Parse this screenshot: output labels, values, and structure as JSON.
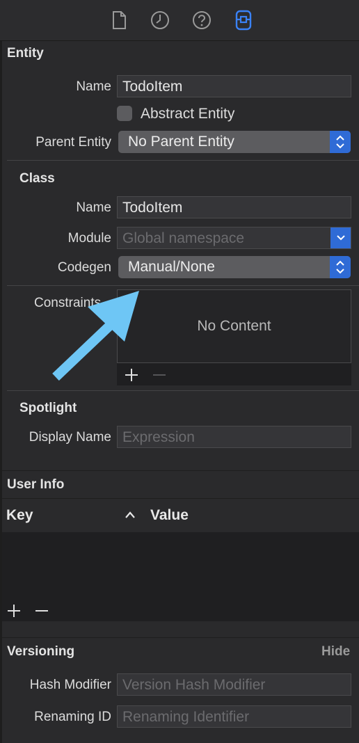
{
  "toolbar": {
    "icons": [
      "file-inspector-icon",
      "history-icon",
      "help-icon",
      "data-model-inspector-icon"
    ],
    "active_color": "#3a82f7"
  },
  "entity": {
    "section_title": "Entity",
    "name_label": "Name",
    "name_value": "TodoItem",
    "abstract_label": "Abstract Entity",
    "parent_label": "Parent Entity",
    "parent_value": "No Parent Entity"
  },
  "class": {
    "section_title": "Class",
    "name_label": "Name",
    "name_value": "TodoItem",
    "module_label": "Module",
    "module_placeholder": "Global namespace",
    "codegen_label": "Codegen",
    "codegen_value": "Manual/None",
    "constraints_label": "Constraints",
    "no_content": "No Content"
  },
  "spotlight": {
    "section_title": "Spotlight",
    "display_name_label": "Display Name",
    "display_name_placeholder": "Expression"
  },
  "user_info": {
    "section_title": "User Info",
    "key_header": "Key",
    "value_header": "Value"
  },
  "versioning": {
    "section_title": "Versioning",
    "hide_label": "Hide",
    "hash_label": "Hash Modifier",
    "hash_placeholder": "Version Hash Modifier",
    "renaming_label": "Renaming ID",
    "renaming_placeholder": "Renaming Identifier"
  },
  "annotation": {
    "arrow_color": "#6ec6f5"
  },
  "colors": {
    "accent_blue": "#2f6bd6"
  }
}
